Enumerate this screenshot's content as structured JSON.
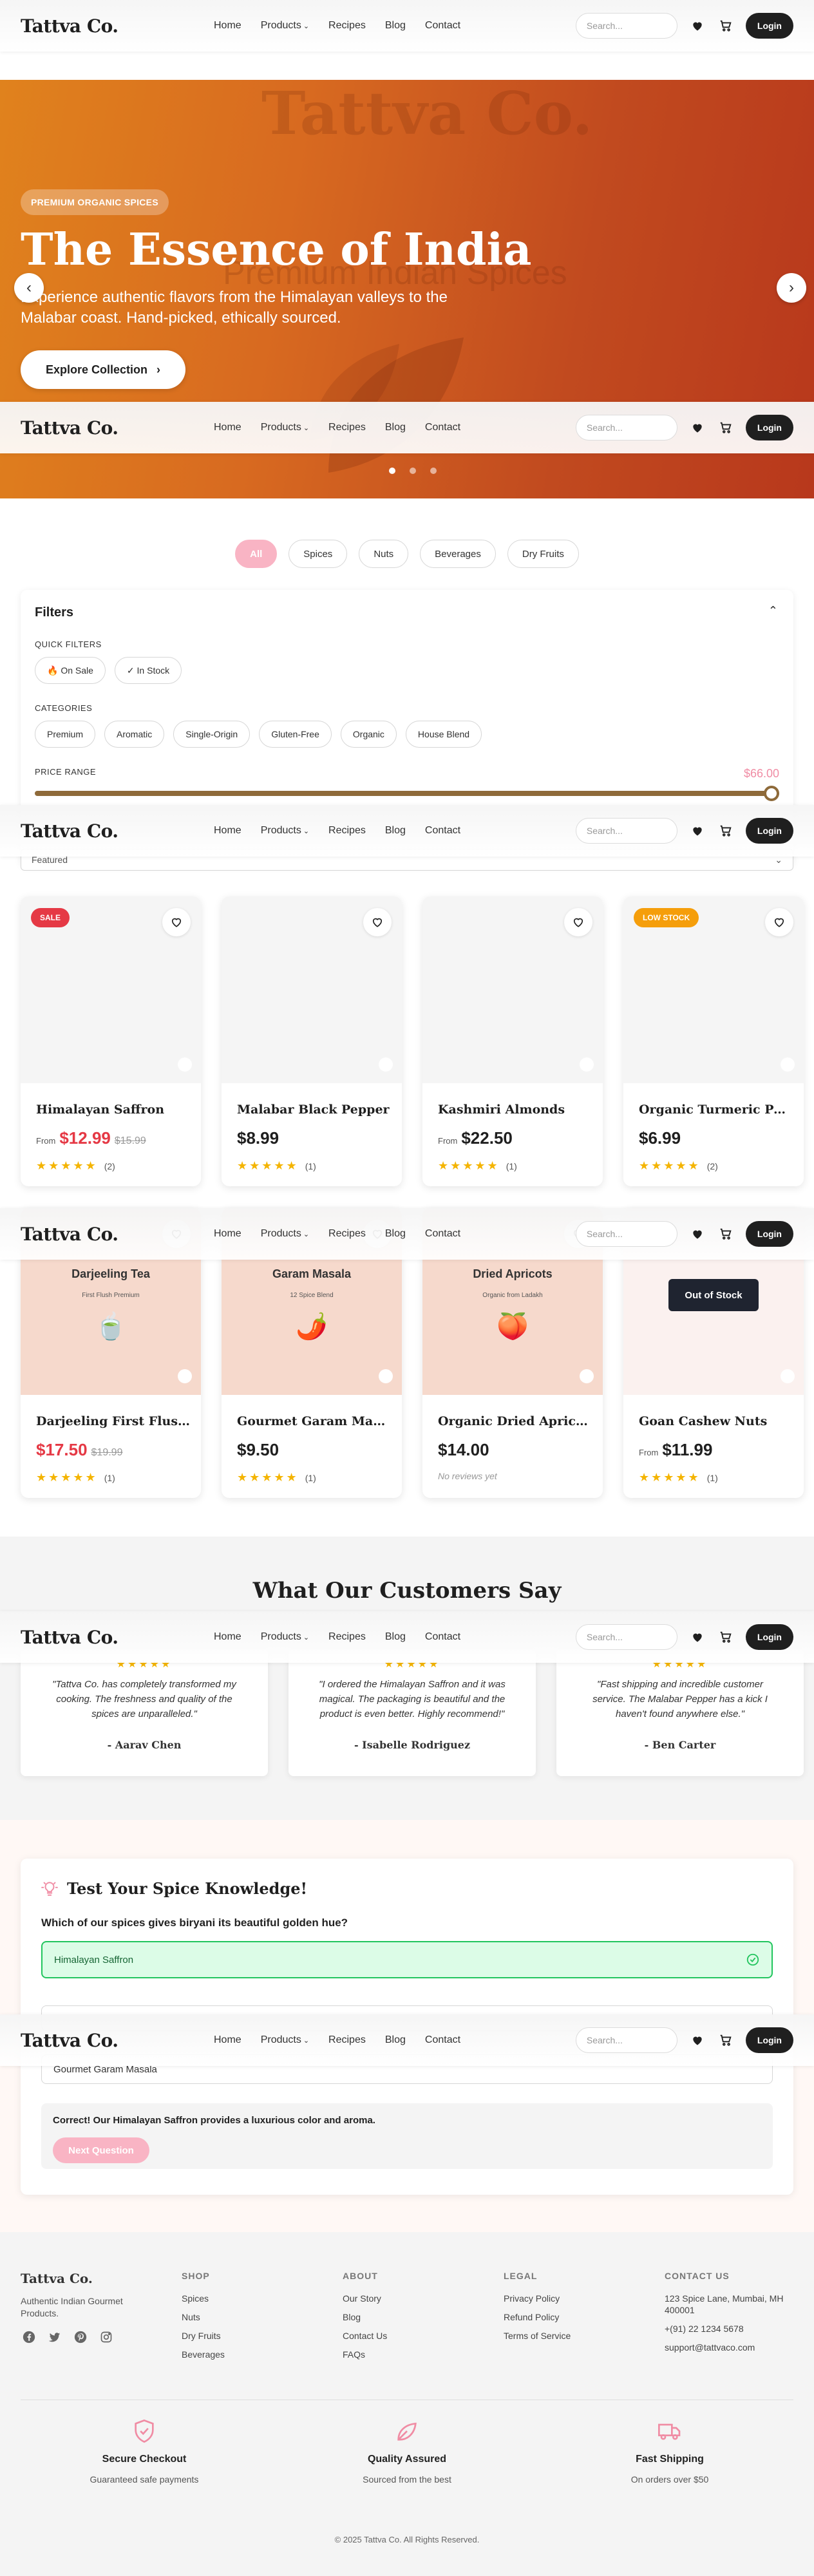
{
  "header": {
    "logo": "Tattva Co.",
    "nav": [
      "Home",
      "Products",
      "Recipes",
      "Blog",
      "Contact"
    ],
    "search_placeholder": "Search...",
    "login_label": "Login"
  },
  "hero": {
    "watermark_title": "Tattva Co.",
    "watermark_subtitle": "Premium Indian Spices",
    "badge": "PREMIUM ORGANIC SPICES",
    "title": "The Essence of India",
    "subtitle": "Experience authentic flavors from the Himalayan valleys to the Malabar coast. Hand-picked, ethically sourced.",
    "cta_label": "Explore Collection",
    "slides_count": 3,
    "active_slide": 1
  },
  "categories": {
    "items": [
      "All",
      "Spices",
      "Nuts",
      "Beverages",
      "Dry Fruits"
    ],
    "active": "All"
  },
  "filters": {
    "title": "Filters",
    "quick_label": "QUICK FILTERS",
    "quick": [
      "🔥 On Sale",
      "✓ In Stock"
    ],
    "categories_label": "CATEGORIES",
    "categories": [
      "Premium",
      "Aromatic",
      "Single-Origin",
      "Gluten-Free",
      "Organic",
      "House Blend"
    ],
    "price_label": "PRICE RANGE",
    "price_value": "$66.00",
    "price_fraction": 1.0,
    "sort_value": "Featured"
  },
  "products": [
    {
      "name": "Himalayan Saffron",
      "from": "From",
      "price": "$12.99",
      "was": "$15.99",
      "sale": true,
      "badge": "SALE",
      "badge_color": "#e53945",
      "rating_count": "(2)",
      "stars": 5
    },
    {
      "name": "Malabar Black Pepper",
      "from": "",
      "price": "$8.99",
      "was": "",
      "sale": false,
      "badge": "",
      "rating_count": "(1)",
      "stars": 5
    },
    {
      "name": "Kashmiri Almonds",
      "from": "From",
      "price": "$22.50",
      "was": "",
      "sale": false,
      "badge": "",
      "rating_count": "(1)",
      "stars": 5
    },
    {
      "name": "Organic Turmeric Powder",
      "from": "",
      "price": "$6.99",
      "was": "",
      "sale": false,
      "badge": "LOW STOCK",
      "badge_color": "#f59e0b",
      "rating_count": "(2)",
      "stars": 5
    },
    {
      "name": "Darjeeling First Flush Tea",
      "from": "",
      "price": "$17.50",
      "was": "$19.99",
      "sale": true,
      "badge": "",
      "rating_count": "(1)",
      "stars": 5,
      "pkg_title": "Darjeeling Tea",
      "pkg_sub": "First Flush Premium",
      "pkg_emoji": "🍵"
    },
    {
      "name": "Gourmet Garam Masala",
      "from": "",
      "price": "$9.50",
      "was": "",
      "sale": false,
      "badge": "",
      "rating_count": "(1)",
      "stars": 5,
      "pkg_title": "Garam Masala",
      "pkg_sub": "12 Spice Blend",
      "pkg_emoji": "🌶️"
    },
    {
      "name": "Organic Dried Apricots",
      "from": "",
      "price": "$14.00",
      "was": "",
      "sale": false,
      "badge": "",
      "no_reviews": "No reviews yet",
      "stars": 0,
      "pkg_title": "Dried Apricots",
      "pkg_sub": "Organic from Ladakh",
      "pkg_emoji": "🍑"
    },
    {
      "name": "Goan Cashew Nuts",
      "from": "From",
      "price": "$11.99",
      "was": "",
      "sale": false,
      "badge": "",
      "rating_count": "(1)",
      "stars": 5,
      "out_of_stock": "Out of Stock"
    }
  ],
  "testimonials": {
    "title": "What Our Customers Say",
    "items": [
      {
        "quote": "\"Tattva Co. has completely transformed my cooking. The freshness and quality of the spices are unparalleled.\"",
        "author": "- Aarav Chen"
      },
      {
        "quote": "\"I ordered the Himalayan Saffron and it was magical. The packaging is beautiful and the product is even better. Highly recommend!\"",
        "author": "- Isabelle Rodriguez"
      },
      {
        "quote": "\"Fast shipping and incredible customer service. The Malabar Pepper has a kick I haven't found anywhere else.\"",
        "author": "- Ben Carter"
      }
    ]
  },
  "quiz": {
    "title": "Test Your Spice Knowledge!",
    "question": "Which of our spices gives biryani its beautiful golden hue?",
    "options": [
      "Himalayan Saffron",
      "",
      "Gourmet Garam Masala"
    ],
    "feedback": "Correct! Our Himalayan Saffron provides a luxurious color and aroma.",
    "next_label": "Next Question"
  },
  "footer": {
    "logo": "Tattva Co.",
    "description": "Authentic Indian Gourmet Products.",
    "shop_title": "SHOP",
    "shop": [
      "Spices",
      "Nuts",
      "Dry Fruits",
      "Beverages"
    ],
    "about_title": "ABOUT",
    "about": [
      "Our Story",
      "Blog",
      "Contact Us",
      "FAQs"
    ],
    "legal_title": "LEGAL",
    "legal": [
      "Privacy Policy",
      "Refund Policy",
      "Terms of Service"
    ],
    "contact_title": "CONTACT US",
    "contact": [
      "123 Spice Lane, Mumbai, MH 400001",
      "+(91) 22 1234 5678",
      "support@tattvaco.com"
    ],
    "features": [
      {
        "title": "Secure Checkout",
        "sub": "Guaranteed safe payments"
      },
      {
        "title": "Quality Assured",
        "sub": "Sourced from the best"
      },
      {
        "title": "Fast Shipping",
        "sub": "On orders over $50"
      }
    ],
    "copyright": "© 2025 Tattva Co. All Rights Reserved."
  },
  "colors": {
    "accent_pink": "#f9b4c4",
    "hero_orange": "#e0821d",
    "hero_red": "#b8381c",
    "sale_red": "#e53945",
    "star_gold": "#f4b400",
    "correct_green": "#22c55e"
  }
}
